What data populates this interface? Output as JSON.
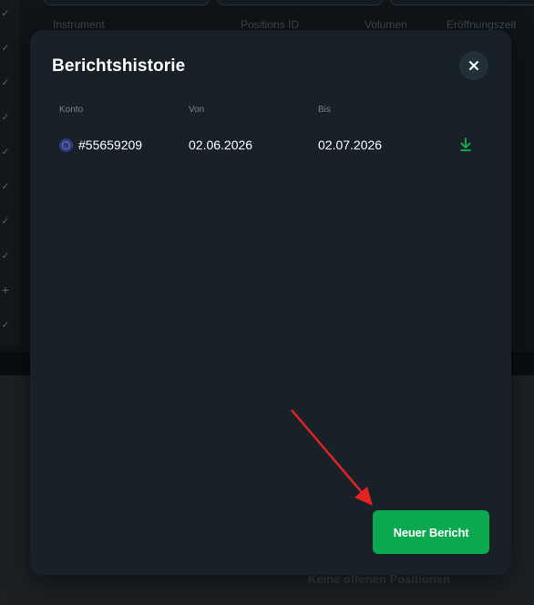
{
  "background": {
    "headers": [
      "Instrument",
      "Positions ID",
      "Volumen",
      "Eröffnungszeit"
    ],
    "empty_text": "Keine offenen Positionen"
  },
  "modal": {
    "title": "Berichtshistorie",
    "columns": {
      "account": "Konto",
      "from": "Von",
      "to": "Bis"
    },
    "rows": [
      {
        "account": "#55659209",
        "from": "02.06.2026",
        "to": "02.07.2026",
        "icon": "download-icon"
      }
    ],
    "new_report_label": "Neuer Bericht",
    "close_icon": "close-icon"
  },
  "colors": {
    "accent": "#0aa84f",
    "annotation_arrow": "#e02424"
  }
}
